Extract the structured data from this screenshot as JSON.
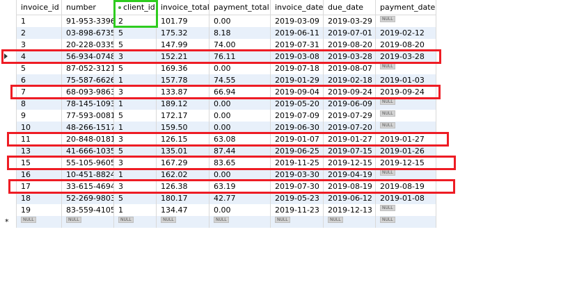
{
  "columns": [
    "invoice_id",
    "number",
    "client_id",
    "invoice_total",
    "payment_total",
    "invoice_date",
    "due_date",
    "payment_date"
  ],
  "null_label": "NULL",
  "new_row_marker": "*",
  "rows": [
    [
      "1",
      "91-953-3396",
      "2",
      "101.79",
      "0.00",
      "2019-03-09",
      "2019-03-29",
      null
    ],
    [
      "2",
      "03-898-6735",
      "5",
      "175.32",
      "8.18",
      "2019-06-11",
      "2019-07-01",
      "2019-02-12"
    ],
    [
      "3",
      "20-228-0335",
      "5",
      "147.99",
      "74.00",
      "2019-07-31",
      "2019-08-20",
      "2019-08-20"
    ],
    [
      "4",
      "56-934-0748",
      "3",
      "152.21",
      "76.11",
      "2019-03-08",
      "2019-03-28",
      "2019-03-28"
    ],
    [
      "5",
      "87-052-3121",
      "5",
      "169.36",
      "0.00",
      "2019-07-18",
      "2019-08-07",
      null
    ],
    [
      "6",
      "75-587-6626",
      "1",
      "157.78",
      "74.55",
      "2019-01-29",
      "2019-02-18",
      "2019-01-03"
    ],
    [
      "7",
      "68-093-9863",
      "3",
      "133.87",
      "66.94",
      "2019-09-04",
      "2019-09-24",
      "2019-09-24"
    ],
    [
      "8",
      "78-145-1093",
      "1",
      "189.12",
      "0.00",
      "2019-05-20",
      "2019-06-09",
      null
    ],
    [
      "9",
      "77-593-0081",
      "5",
      "172.17",
      "0.00",
      "2019-07-09",
      "2019-07-29",
      null
    ],
    [
      "10",
      "48-266-1517",
      "1",
      "159.50",
      "0.00",
      "2019-06-30",
      "2019-07-20",
      null
    ],
    [
      "11",
      "20-848-0181",
      "3",
      "126.15",
      "63.08",
      "2019-01-07",
      "2019-01-27",
      "2019-01-27"
    ],
    [
      "13",
      "41-666-1035",
      "5",
      "135.01",
      "87.44",
      "2019-06-25",
      "2019-07-15",
      "2019-01-26"
    ],
    [
      "15",
      "55-105-9605",
      "3",
      "167.29",
      "83.65",
      "2019-11-25",
      "2019-12-15",
      "2019-12-15"
    ],
    [
      "16",
      "10-451-8824",
      "1",
      "162.02",
      "0.00",
      "2019-03-30",
      "2019-04-19",
      null
    ],
    [
      "17",
      "33-615-4694",
      "3",
      "126.38",
      "63.19",
      "2019-07-30",
      "2019-08-19",
      "2019-08-19"
    ],
    [
      "18",
      "52-269-9803",
      "5",
      "180.17",
      "42.77",
      "2019-05-23",
      "2019-06-12",
      "2019-01-08"
    ],
    [
      "19",
      "83-559-4105",
      "1",
      "134.47",
      "0.00",
      "2019-11-23",
      "2019-12-13",
      null
    ]
  ],
  "current_row_index": 3,
  "sorted_column_index": 2,
  "highlighted_rows": [
    3,
    6,
    10,
    12,
    14
  ],
  "highlighted_column": 2,
  "colors": {
    "highlight_red": "#ee1c24",
    "highlight_green": "#2ecc1f",
    "alt_row": "#e8f0fa"
  }
}
